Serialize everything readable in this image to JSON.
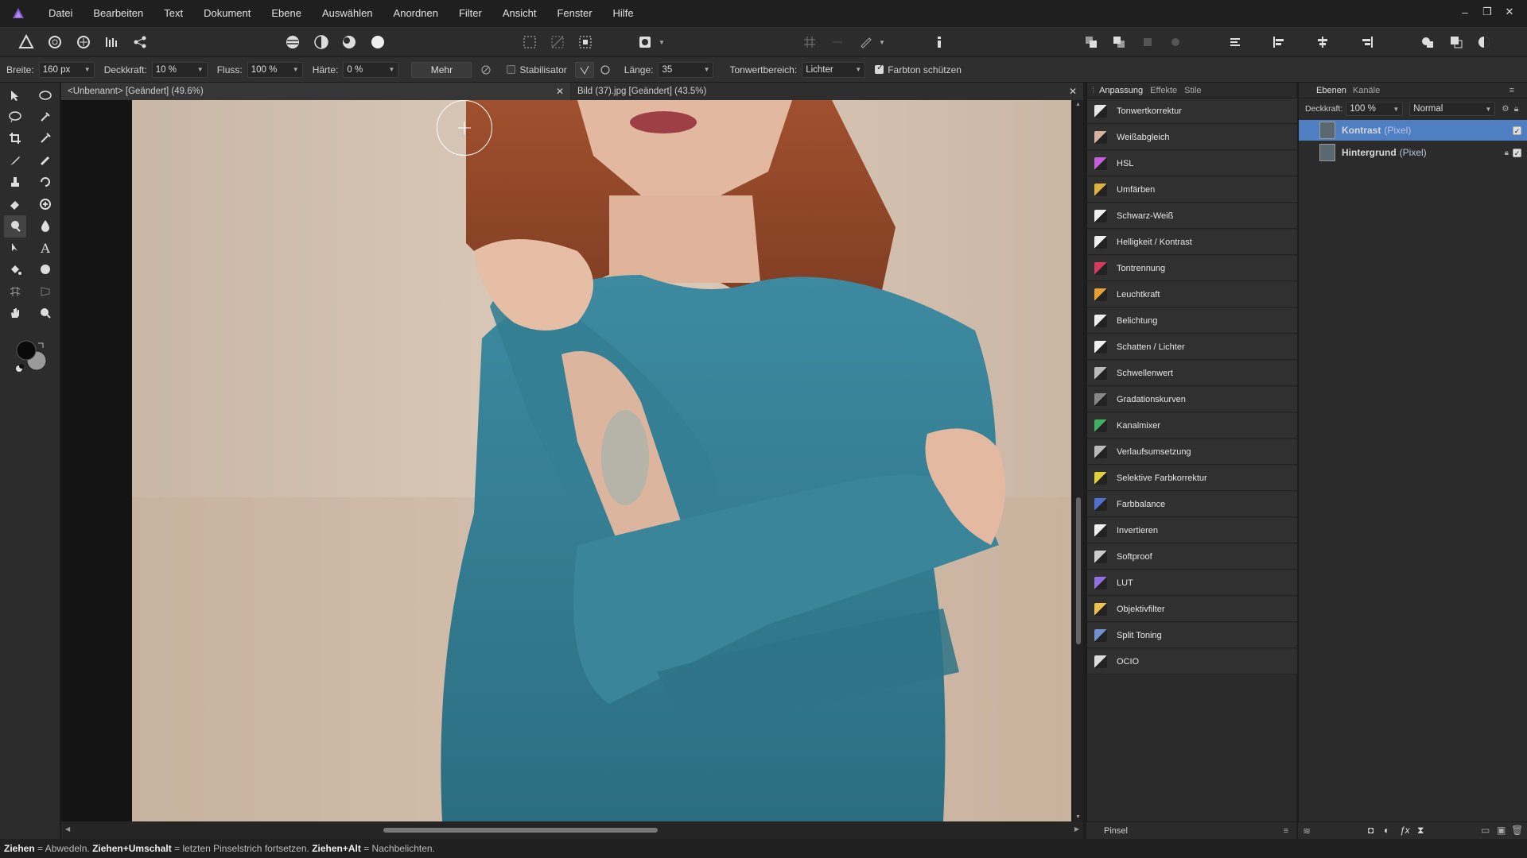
{
  "menu": [
    "Datei",
    "Bearbeiten",
    "Text",
    "Dokument",
    "Ebene",
    "Auswählen",
    "Anordnen",
    "Filter",
    "Ansicht",
    "Fenster",
    "Hilfe"
  ],
  "window_controls": [
    "–",
    "❐",
    "✕"
  ],
  "context": {
    "width_label": "Breite:",
    "width_value": "160 px",
    "opacity_label": "Deckkraft:",
    "opacity_value": "10 %",
    "flow_label": "Fluss:",
    "flow_value": "100 %",
    "hardness_label": "Härte:",
    "hardness_value": "0 %",
    "more_label": "Mehr",
    "stabilizer_label": "Stabilisator",
    "length_label": "Länge:",
    "length_value": "35",
    "tonal_label": "Tonwertbereich:",
    "tonal_value": "Lichter",
    "protect_hue_label": "Farbton schützen"
  },
  "tabs": [
    {
      "label": "<Unbenannt> [Geändert] (49.6%)",
      "close": "✕"
    },
    {
      "label": "Bild (37).jpg [Geändert] (43.5%)",
      "close": "✕"
    }
  ],
  "adjustments": {
    "tabs": [
      "Anpassung",
      "Effekte",
      "Stile"
    ],
    "items": [
      {
        "label": "Tonwertkorrektur",
        "icon": "levels-icon",
        "color": "#e8e8e8"
      },
      {
        "label": "Weißabgleich",
        "icon": "white-balance-icon",
        "color": "#d8b0a0"
      },
      {
        "label": "HSL",
        "icon": "hsl-icon",
        "color": "#c35fd8"
      },
      {
        "label": "Umfärben",
        "icon": "recolor-icon",
        "color": "#e0b040"
      },
      {
        "label": "Schwarz-Weiß",
        "icon": "black-white-icon",
        "color": "#f0f0f0"
      },
      {
        "label": "Helligkeit / Kontrast",
        "icon": "brightness-contrast-icon",
        "color": "#f0f0f0"
      },
      {
        "label": "Tontrennung",
        "icon": "posterize-icon",
        "color": "#d43b5a"
      },
      {
        "label": "Leuchtkraft",
        "icon": "vibrance-icon",
        "color": "#e6a030"
      },
      {
        "label": "Belichtung",
        "icon": "exposure-icon",
        "color": "#f0f0f0"
      },
      {
        "label": "Schatten / Lichter",
        "icon": "shadows-highlights-icon",
        "color": "#f0f0f0"
      },
      {
        "label": "Schwellenwert",
        "icon": "threshold-icon",
        "color": "#bbbbbb"
      },
      {
        "label": "Gradationskurven",
        "icon": "curves-icon",
        "color": "#888888"
      },
      {
        "label": "Kanalmixer",
        "icon": "channel-mixer-icon",
        "color": "#40b060"
      },
      {
        "label": "Verlaufsumsetzung",
        "icon": "gradient-map-icon",
        "color": "#bbbbbb"
      },
      {
        "label": "Selektive Farbkorrektur",
        "icon": "selective-color-icon",
        "color": "#e0d040"
      },
      {
        "label": "Farbbalance",
        "icon": "color-balance-icon",
        "color": "#5070d0"
      },
      {
        "label": "Invertieren",
        "icon": "invert-icon",
        "color": "#f0f0f0"
      },
      {
        "label": "Softproof",
        "icon": "soft-proof-icon",
        "color": "#cccccc"
      },
      {
        "label": "LUT",
        "icon": "lut-icon",
        "color": "#9070e0"
      },
      {
        "label": "Objektivfilter",
        "icon": "lens-filter-icon",
        "color": "#f0c050"
      },
      {
        "label": "Split Toning",
        "icon": "split-toning-icon",
        "color": "#7090d0"
      },
      {
        "label": "OCIO",
        "icon": "ocio-icon",
        "color": "#dddddd"
      }
    ]
  },
  "layers": {
    "tabs": [
      "Ebenen",
      "Kanäle"
    ],
    "opacity_label": "Deckkraft:",
    "opacity_value": "100 %",
    "blend_mode": "Normal",
    "items": [
      {
        "name": "Kontrast",
        "type": "(Pixel)",
        "selected": true,
        "check": "✓"
      },
      {
        "name": "Hintergrund",
        "type": "(Pixel)",
        "selected": false,
        "check": "✓"
      }
    ]
  },
  "bottom_panel_label": "Pinsel",
  "status": {
    "p1": "Ziehen",
    "t1": " = Abwedeln. ",
    "p2": "Ziehen+Umschalt",
    "t2": " = letzten Pinselstrich fortsetzen. ",
    "p3": "Ziehen+Alt",
    "t3": " = Nachbelichten."
  }
}
